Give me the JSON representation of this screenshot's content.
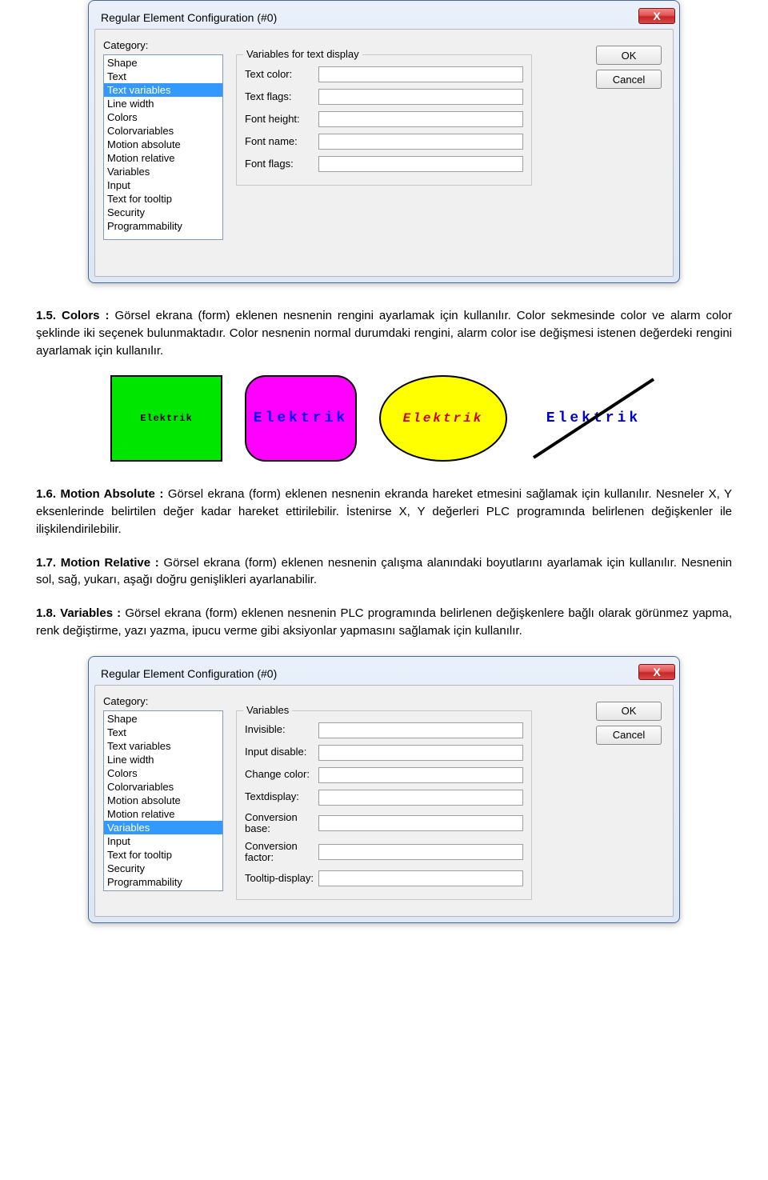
{
  "dialog1": {
    "title": "Regular Element Configuration (#0)",
    "close_glyph": "X",
    "category_label": "Category:",
    "categories": [
      "Shape",
      "Text",
      "Text variables",
      "Line width",
      "Colors",
      "Colorvariables",
      "Motion absolute",
      "Motion relative",
      "Variables",
      "Input",
      "Text for tooltip",
      "Security",
      "Programmability"
    ],
    "selected_index": 2,
    "groupbox_title": "Variables for text display",
    "fields": [
      {
        "label": "Text color:",
        "value": ""
      },
      {
        "label": "Text flags:",
        "value": ""
      },
      {
        "label": "Font height:",
        "value": ""
      },
      {
        "label": "Font name:",
        "value": ""
      },
      {
        "label": "Font flags:",
        "value": ""
      }
    ],
    "ok_label": "OK",
    "cancel_label": "Cancel"
  },
  "shapes": {
    "square": "Elektrik",
    "rrect": "Elektrik",
    "ellipse": "Elektrik",
    "line": "Elektrik"
  },
  "article": {
    "p15_bold": "1.5. Colors : ",
    "p15": "Görsel ekrana (form) eklenen nesnenin rengini ayarlamak için kullanılır. Color sekmesinde color ve alarm color şeklinde iki seçenek bulunmaktadır. Color nesnenin normal durumdaki rengini, alarm color ise değişmesi istenen değerdeki rengini ayarlamak için kullanılır.",
    "p16_bold": "1.6. Motion Absolute : ",
    "p16": "Görsel ekrana (form) eklenen nesnenin ekranda hareket etmesini sağlamak için kullanılır. Nesneler X, Y eksenlerinde belirtilen değer kadar hareket ettirilebilir. İstenirse X, Y değerleri PLC programında belirlenen değişkenler ile ilişkilendirilebilir.",
    "p17_bold": "1.7. Motion Relative : ",
    "p17": "Görsel ekrana (form) eklenen nesnenin çalışma alanındaki boyutlarını ayarlamak için kullanılır. Nesnenin sol, sağ, yukarı, aşağı doğru genişlikleri ayarlanabilir.",
    "p18_bold": "1.8. Variables : ",
    "p18": "Görsel ekrana (form) eklenen nesnenin PLC programında belirlenen değişkenlere bağlı olarak görünmez yapma, renk değiştirme, yazı yazma, ipucu verme gibi aksiyonlar yapmasını sağlamak için kullanılır."
  },
  "dialog2": {
    "title": "Regular Element Configuration (#0)",
    "close_glyph": "X",
    "category_label": "Category:",
    "categories": [
      "Shape",
      "Text",
      "Text variables",
      "Line width",
      "Colors",
      "Colorvariables",
      "Motion absolute",
      "Motion relative",
      "Variables",
      "Input",
      "Text for tooltip",
      "Security",
      "Programmability"
    ],
    "selected_index": 8,
    "groupbox_title": "Variables",
    "fields": [
      {
        "label": "Invisible:",
        "value": ""
      },
      {
        "label": "Input disable:",
        "value": ""
      },
      {
        "label": "Change color:",
        "value": ""
      },
      {
        "label": "Textdisplay:",
        "value": ""
      },
      {
        "label": "Conversion base:",
        "value": ""
      },
      {
        "label": "Conversion factor:",
        "value": ""
      },
      {
        "label": "Tooltip-display:",
        "value": ""
      }
    ],
    "ok_label": "OK",
    "cancel_label": "Cancel"
  }
}
